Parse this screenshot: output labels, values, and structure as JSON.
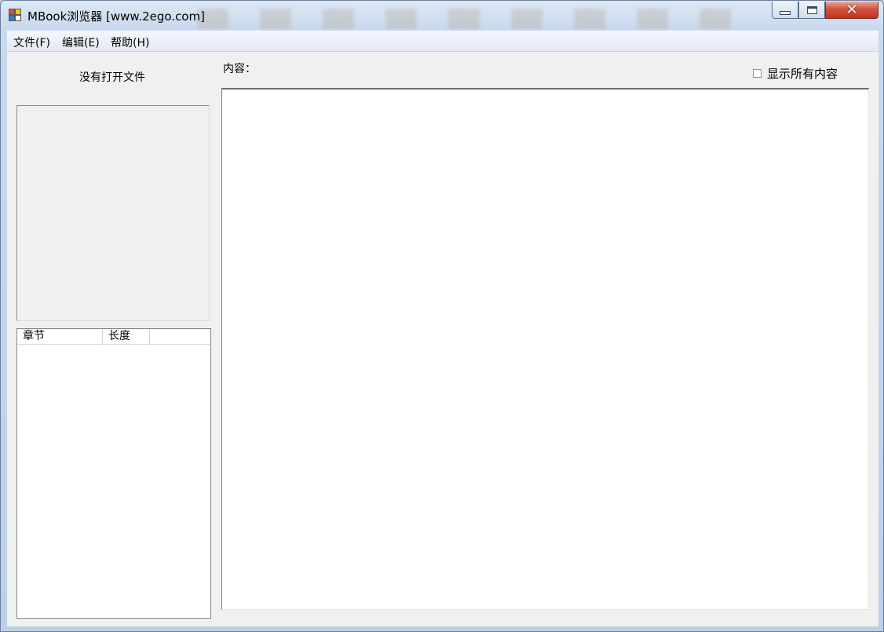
{
  "window": {
    "title": "MBook浏览器 [www.2ego.com]",
    "close_glyph": "✕"
  },
  "menu": {
    "items": [
      {
        "label": "文件(F)"
      },
      {
        "label": "编辑(E)"
      },
      {
        "label": "帮助(H)"
      }
    ]
  },
  "left_panel": {
    "status": "没有打开文件",
    "list_columns": [
      "章节",
      "长度"
    ]
  },
  "main": {
    "content_label": "内容：",
    "show_all_label": "显示所有内容",
    "show_all_checked": false
  },
  "icons": {
    "app": "app-icon",
    "minimize": "minimize-icon",
    "maximize": "maximize-icon",
    "close": "close-icon"
  }
}
